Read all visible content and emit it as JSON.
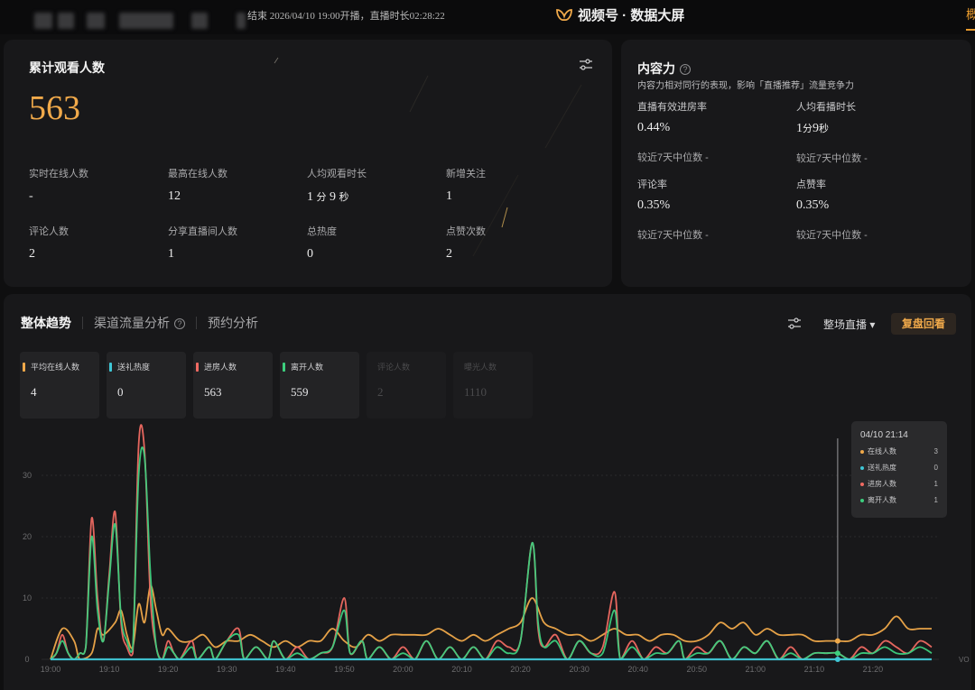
{
  "topbar": {
    "status_text": "结束 2026/04/10 19:00开播，直播时长02:28:22",
    "brand_title": "视频号 · 数据大屏",
    "right_mark": "概"
  },
  "overview": {
    "title": "累计观看人数",
    "total_viewers": "563",
    "stats": [
      {
        "label": "实时在线人数",
        "value": "-"
      },
      {
        "label": "最高在线人数",
        "value": "12"
      },
      {
        "label": "人均观看时长",
        "value": "1",
        "unit1": "分",
        "value2": "9",
        "unit2": "秒"
      },
      {
        "label": "新增关注",
        "value": "1"
      },
      {
        "label": "评论人数",
        "value": "2"
      },
      {
        "label": "分享直播间人数",
        "value": "1"
      },
      {
        "label": "总热度",
        "value": "0"
      },
      {
        "label": "点赞次数",
        "value": "2"
      }
    ]
  },
  "content_power": {
    "title": "内容力",
    "help_icon": "?",
    "subtitle": "内容力相对同行的表现，影响「直播推荐」流量竞争力",
    "metrics": [
      {
        "label": "直播有效进房率",
        "value": "0.44%",
        "compare": "较近7天中位数 -"
      },
      {
        "label": "人均看播时长",
        "value": "1",
        "unit1": "分",
        "value2": "9",
        "unit2": "秒",
        "compare": "较近7天中位数 -"
      },
      {
        "label": "评论率",
        "value": "0.35%",
        "compare": "较近7天中位数 -"
      },
      {
        "label": "点赞率",
        "value": "0.35%",
        "compare": "较近7天中位数 -"
      }
    ]
  },
  "trend": {
    "tabs": [
      "整体趋势",
      "渠道流量分析",
      "预约分析"
    ],
    "tab_help_icon": "?",
    "scope_dropdown": "整场直播 ▾",
    "replay_button": "复盘回看",
    "cards": [
      {
        "label": "平均在线人数",
        "value": "4",
        "color": "#f0a94a",
        "active": true
      },
      {
        "label": "送礼热度",
        "value": "0",
        "color": "#3fc7d6",
        "active": true
      },
      {
        "label": "进房人数",
        "value": "563",
        "color": "#f06a62",
        "active": true
      },
      {
        "label": "离开人数",
        "value": "559",
        "color": "#3dcf7e",
        "active": true
      },
      {
        "label": "评论人数",
        "value": "2",
        "color": "#333335",
        "active": false
      },
      {
        "label": "曝光人数",
        "value": "1110",
        "color": "#333335",
        "active": false
      }
    ],
    "tooltip": {
      "title": "04/10 21:14",
      "rows": [
        {
          "label": "在线人数",
          "value": "3",
          "color": "#f0a94a"
        },
        {
          "label": "送礼热度",
          "value": "0",
          "color": "#3fc7d6"
        },
        {
          "label": "进房人数",
          "value": "1",
          "color": "#f06a62"
        },
        {
          "label": "离开人数",
          "value": "1",
          "color": "#3dcf7e"
        }
      ]
    }
  },
  "chart_data": {
    "type": "line",
    "x_labels": [
      "19:00",
      "19:10",
      "19:20",
      "19:30",
      "19:40",
      "19:50",
      "20:00",
      "20:10",
      "20:20",
      "20:30",
      "20:40",
      "20:50",
      "21:00",
      "21:10",
      "21:20"
    ],
    "x_start_minute": 0,
    "x_end_minute": 150,
    "y_ticks": [
      "0",
      "10",
      "20",
      "30"
    ],
    "ylim": [
      0,
      35
    ],
    "right_axis_label": "VO",
    "hover_minute": 134,
    "series": [
      {
        "name": "平均在线人数",
        "color": "#f0a94a",
        "points": [
          [
            0,
            0
          ],
          [
            2,
            5
          ],
          [
            4,
            3
          ],
          [
            5,
            0
          ],
          [
            7,
            1
          ],
          [
            8,
            5
          ],
          [
            9,
            4
          ],
          [
            11,
            6
          ],
          [
            12,
            8
          ],
          [
            13,
            4
          ],
          [
            14,
            2
          ],
          [
            15,
            9
          ],
          [
            16,
            6
          ],
          [
            17,
            12
          ],
          [
            18,
            8
          ],
          [
            19,
            4
          ],
          [
            20,
            5
          ],
          [
            22,
            3
          ],
          [
            24,
            3
          ],
          [
            26,
            4
          ],
          [
            28,
            2
          ],
          [
            30,
            3
          ],
          [
            32,
            3
          ],
          [
            34,
            4
          ],
          [
            36,
            3
          ],
          [
            38,
            2
          ],
          [
            40,
            3
          ],
          [
            42,
            2
          ],
          [
            44,
            3
          ],
          [
            46,
            3
          ],
          [
            48,
            5
          ],
          [
            50,
            3
          ],
          [
            52,
            2
          ],
          [
            54,
            4
          ],
          [
            56,
            3
          ],
          [
            58,
            4
          ],
          [
            60,
            4
          ],
          [
            62,
            4
          ],
          [
            64,
            4
          ],
          [
            66,
            5
          ],
          [
            68,
            4
          ],
          [
            70,
            3
          ],
          [
            72,
            4
          ],
          [
            74,
            3
          ],
          [
            76,
            4
          ],
          [
            78,
            5
          ],
          [
            80,
            6
          ],
          [
            82,
            10
          ],
          [
            84,
            6
          ],
          [
            86,
            5
          ],
          [
            88,
            4
          ],
          [
            90,
            4
          ],
          [
            92,
            3
          ],
          [
            94,
            4
          ],
          [
            96,
            5
          ],
          [
            98,
            4
          ],
          [
            100,
            4
          ],
          [
            102,
            3
          ],
          [
            104,
            4
          ],
          [
            106,
            4
          ],
          [
            108,
            3
          ],
          [
            110,
            3
          ],
          [
            112,
            4
          ],
          [
            114,
            6
          ],
          [
            116,
            5
          ],
          [
            118,
            6
          ],
          [
            120,
            4
          ],
          [
            122,
            5
          ],
          [
            124,
            4
          ],
          [
            126,
            4
          ],
          [
            128,
            4
          ],
          [
            130,
            3
          ],
          [
            132,
            3
          ],
          [
            134,
            3
          ],
          [
            136,
            3
          ],
          [
            138,
            4
          ],
          [
            140,
            4
          ],
          [
            142,
            5
          ],
          [
            144,
            7
          ],
          [
            146,
            5
          ],
          [
            148,
            5
          ],
          [
            150,
            5
          ]
        ]
      },
      {
        "name": "进房人数",
        "color": "#f06a62",
        "points": [
          [
            0,
            0
          ],
          [
            1,
            1
          ],
          [
            2,
            4
          ],
          [
            3,
            1
          ],
          [
            4,
            0
          ],
          [
            5,
            1
          ],
          [
            6,
            2
          ],
          [
            7,
            23
          ],
          [
            8,
            10
          ],
          [
            9,
            3
          ],
          [
            10,
            14
          ],
          [
            11,
            24
          ],
          [
            12,
            6
          ],
          [
            13,
            2
          ],
          [
            14,
            1
          ],
          [
            15,
            35
          ],
          [
            16,
            34
          ],
          [
            17,
            10
          ],
          [
            18,
            2
          ],
          [
            19,
            0
          ],
          [
            20,
            3
          ],
          [
            21,
            1
          ],
          [
            22,
            0
          ],
          [
            24,
            3
          ],
          [
            25,
            0
          ],
          [
            27,
            2
          ],
          [
            28,
            0
          ],
          [
            30,
            3
          ],
          [
            32,
            5
          ],
          [
            33,
            0
          ],
          [
            35,
            2
          ],
          [
            37,
            0
          ],
          [
            38,
            3
          ],
          [
            40,
            0
          ],
          [
            42,
            2
          ],
          [
            44,
            0
          ],
          [
            46,
            1
          ],
          [
            48,
            2
          ],
          [
            50,
            10
          ],
          [
            51,
            1
          ],
          [
            53,
            3
          ],
          [
            54,
            0
          ],
          [
            56,
            2
          ],
          [
            58,
            0
          ],
          [
            60,
            2
          ],
          [
            62,
            0
          ],
          [
            64,
            3
          ],
          [
            66,
            0
          ],
          [
            68,
            2
          ],
          [
            70,
            0
          ],
          [
            72,
            2
          ],
          [
            74,
            0
          ],
          [
            76,
            3
          ],
          [
            78,
            2
          ],
          [
            80,
            3
          ],
          [
            82,
            19
          ],
          [
            83,
            5
          ],
          [
            84,
            2
          ],
          [
            86,
            4
          ],
          [
            88,
            0
          ],
          [
            90,
            3
          ],
          [
            92,
            1
          ],
          [
            94,
            2
          ],
          [
            96,
            11
          ],
          [
            97,
            0
          ],
          [
            99,
            3
          ],
          [
            101,
            0
          ],
          [
            103,
            2
          ],
          [
            105,
            1
          ],
          [
            107,
            3
          ],
          [
            108,
            0
          ],
          [
            110,
            2
          ],
          [
            112,
            1
          ],
          [
            114,
            3
          ],
          [
            116,
            0
          ],
          [
            118,
            2
          ],
          [
            120,
            1
          ],
          [
            122,
            3
          ],
          [
            124,
            0
          ],
          [
            126,
            2
          ],
          [
            128,
            0
          ],
          [
            130,
            1
          ],
          [
            132,
            1
          ],
          [
            134,
            1
          ],
          [
            136,
            0
          ],
          [
            138,
            2
          ],
          [
            140,
            1
          ],
          [
            142,
            3
          ],
          [
            144,
            2
          ],
          [
            146,
            1
          ],
          [
            148,
            3
          ],
          [
            150,
            2
          ]
        ]
      },
      {
        "name": "离开人数",
        "color": "#3dcf7e",
        "points": [
          [
            0,
            0
          ],
          [
            1,
            1
          ],
          [
            2,
            3
          ],
          [
            3,
            1
          ],
          [
            4,
            0
          ],
          [
            5,
            1
          ],
          [
            6,
            2
          ],
          [
            7,
            20
          ],
          [
            8,
            8
          ],
          [
            9,
            3
          ],
          [
            10,
            13
          ],
          [
            11,
            22
          ],
          [
            12,
            7
          ],
          [
            13,
            3
          ],
          [
            14,
            2
          ],
          [
            15,
            30
          ],
          [
            16,
            33
          ],
          [
            17,
            14
          ],
          [
            18,
            2
          ],
          [
            19,
            0
          ],
          [
            20,
            2
          ],
          [
            21,
            1
          ],
          [
            22,
            0
          ],
          [
            24,
            2
          ],
          [
            25,
            0
          ],
          [
            27,
            2
          ],
          [
            28,
            0
          ],
          [
            30,
            3
          ],
          [
            32,
            4
          ],
          [
            33,
            0
          ],
          [
            35,
            2
          ],
          [
            37,
            0
          ],
          [
            38,
            3
          ],
          [
            40,
            0
          ],
          [
            42,
            1
          ],
          [
            44,
            0
          ],
          [
            46,
            1
          ],
          [
            48,
            2
          ],
          [
            50,
            8
          ],
          [
            51,
            1
          ],
          [
            53,
            3
          ],
          [
            54,
            0
          ],
          [
            56,
            2
          ],
          [
            58,
            0
          ],
          [
            60,
            1
          ],
          [
            62,
            0
          ],
          [
            64,
            3
          ],
          [
            66,
            0
          ],
          [
            68,
            2
          ],
          [
            70,
            0
          ],
          [
            72,
            2
          ],
          [
            74,
            0
          ],
          [
            76,
            2
          ],
          [
            78,
            1
          ],
          [
            80,
            3
          ],
          [
            82,
            19
          ],
          [
            83,
            6
          ],
          [
            84,
            2
          ],
          [
            86,
            3
          ],
          [
            88,
            0
          ],
          [
            90,
            3
          ],
          [
            92,
            1
          ],
          [
            94,
            1
          ],
          [
            96,
            8
          ],
          [
            97,
            0
          ],
          [
            99,
            2
          ],
          [
            101,
            0
          ],
          [
            103,
            1
          ],
          [
            105,
            1
          ],
          [
            107,
            3
          ],
          [
            108,
            0
          ],
          [
            110,
            1
          ],
          [
            112,
            1
          ],
          [
            114,
            3
          ],
          [
            116,
            0
          ],
          [
            118,
            2
          ],
          [
            120,
            1
          ],
          [
            122,
            3
          ],
          [
            124,
            0
          ],
          [
            126,
            1
          ],
          [
            128,
            0
          ],
          [
            130,
            1
          ],
          [
            132,
            1
          ],
          [
            134,
            1
          ],
          [
            136,
            0
          ],
          [
            138,
            1
          ],
          [
            140,
            1
          ],
          [
            142,
            2
          ],
          [
            144,
            1
          ],
          [
            146,
            1
          ],
          [
            148,
            2
          ],
          [
            150,
            1
          ]
        ]
      },
      {
        "name": "送礼热度",
        "color": "#3fc7d6",
        "points": [
          [
            0,
            0
          ],
          [
            150,
            0
          ]
        ]
      }
    ]
  }
}
